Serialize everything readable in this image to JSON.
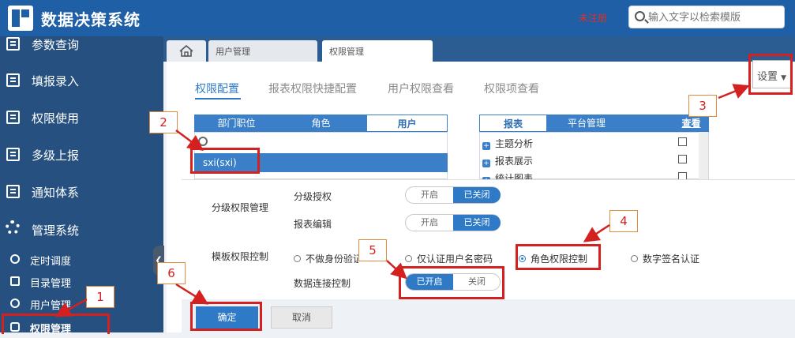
{
  "app": {
    "title": "数据决策系统",
    "unregistered": "未注册"
  },
  "search": {
    "placeholder": "输入文字以检索模版"
  },
  "sidebar": {
    "items": [
      {
        "label": "参数查询",
        "icon": "list-icon"
      },
      {
        "label": "填报录入",
        "icon": "list-icon"
      },
      {
        "label": "权限使用",
        "icon": "list-icon"
      },
      {
        "label": "多级上报",
        "icon": "list-icon"
      },
      {
        "label": "通知体系",
        "icon": "list-icon"
      },
      {
        "label": "管理系统",
        "icon": "gear-icon"
      }
    ],
    "sub_items": [
      {
        "label": "定时调度",
        "icon": "clock-icon"
      },
      {
        "label": "目录管理",
        "icon": "folder-icon"
      },
      {
        "label": "用户管理",
        "icon": "user-icon"
      },
      {
        "label": "权限管理",
        "icon": "lock-icon"
      }
    ]
  },
  "tabs": [
    {
      "label": "用户管理"
    },
    {
      "label": "权限管理"
    }
  ],
  "subnav": [
    "权限配置",
    "报表权限快捷配置",
    "用户权限查看",
    "权限项查看"
  ],
  "settings_label": "设置",
  "left_panel": {
    "headers": [
      "部门职位",
      "角色",
      "用户"
    ],
    "selected_row": "sxi(sxi)"
  },
  "right_panel": {
    "headers": [
      "报表",
      "平台管理",
      "查看"
    ],
    "tree": [
      "主题分析",
      "报表展示",
      "统计图表"
    ]
  },
  "dialog": {
    "grading_label": "分级权限管理",
    "grading_auth_label": "分级授权",
    "report_edit_label": "报表编辑",
    "toggle_on": "开启",
    "toggle_closed": "已关闭",
    "template_label": "模板权限控制",
    "radios": [
      "不做身份验证",
      "仅认证用户名密码",
      "角色权限控制",
      "数字签名认证"
    ],
    "selected_radio": "角色权限控制",
    "db_label": "数据连接控制",
    "db_toggle_on": "已开启",
    "db_toggle_off": "关闭",
    "ok": "确定",
    "cancel": "取消"
  },
  "annotations": [
    "1",
    "2",
    "3",
    "4",
    "5",
    "6"
  ],
  "colors": {
    "header": "#1f5fa6",
    "sidebar": "#26507f",
    "accent": "#2f7ac7",
    "annotation": "#d52020"
  }
}
